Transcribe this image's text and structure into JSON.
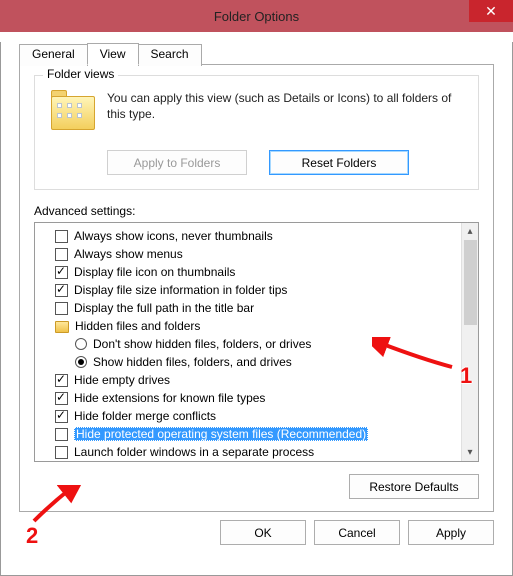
{
  "window": {
    "title": "Folder Options"
  },
  "tabs": {
    "general": "General",
    "view": "View",
    "search": "Search"
  },
  "folderViews": {
    "legend": "Folder views",
    "desc": "You can apply this view (such as Details or Icons) to all folders of this type.",
    "applyBtn": "Apply to Folders",
    "resetBtn": "Reset Folders"
  },
  "adv": {
    "label": "Advanced settings:",
    "items": [
      {
        "type": "check",
        "checked": false,
        "label": "Always show icons, never thumbnails"
      },
      {
        "type": "check",
        "checked": false,
        "label": "Always show menus"
      },
      {
        "type": "check",
        "checked": true,
        "label": "Display file icon on thumbnails"
      },
      {
        "type": "check",
        "checked": true,
        "label": "Display file size information in folder tips"
      },
      {
        "type": "check",
        "checked": false,
        "label": "Display the full path in the title bar"
      },
      {
        "type": "folder",
        "label": "Hidden files and folders"
      },
      {
        "type": "radio",
        "selected": false,
        "label": "Don't show hidden files, folders, or drives"
      },
      {
        "type": "radio",
        "selected": true,
        "label": "Show hidden files, folders, and drives"
      },
      {
        "type": "check",
        "checked": true,
        "label": "Hide empty drives"
      },
      {
        "type": "check",
        "checked": true,
        "label": "Hide extensions for known file types"
      },
      {
        "type": "check",
        "checked": true,
        "label": "Hide folder merge conflicts"
      },
      {
        "type": "check",
        "checked": false,
        "selectedRow": true,
        "label": "Hide protected operating system files (Recommended)"
      },
      {
        "type": "check",
        "checked": false,
        "label": "Launch folder windows in a separate process"
      }
    ],
    "restore": "Restore Defaults"
  },
  "dlgButtons": {
    "ok": "OK",
    "cancel": "Cancel",
    "apply": "Apply"
  },
  "annotations": {
    "n1": "1",
    "n2": "2"
  }
}
